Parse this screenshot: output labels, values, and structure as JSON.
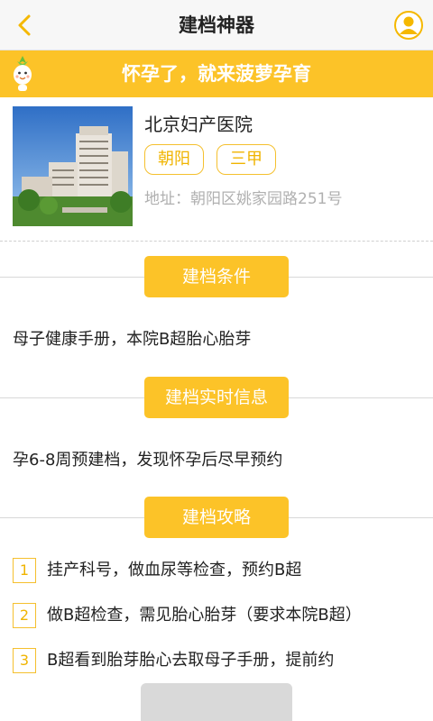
{
  "header": {
    "title": "建档神器",
    "back_icon": "chevron-left-icon",
    "user_icon": "user-avatar-icon"
  },
  "banner": {
    "text": "怀孕了，就来菠萝孕育",
    "mascot_icon": "pineapple-mascot-icon"
  },
  "hospital": {
    "name": "北京妇产医院",
    "district": "朝阳",
    "grade": "三甲",
    "address": "地址：朝阳区姚家园路251号"
  },
  "sections": {
    "conditions": {
      "title": "建档条件",
      "body": "母子健康手册，本院B超胎心胎芽"
    },
    "realtime": {
      "title": "建档实时信息",
      "body": "孕6-8周预建档，发现怀孕后尽早预约"
    },
    "guide": {
      "title": "建档攻略",
      "steps": [
        {
          "num": "1",
          "text": "挂产科号，做血尿等检查，预约B超"
        },
        {
          "num": "2",
          "text": "做B超检查，需见胎心胎芽（要求本院B超）"
        },
        {
          "num": "3",
          "text": "B超看到胎芽胎心去取母子手册，提前约"
        }
      ]
    }
  },
  "colors": {
    "accent": "#fcc328",
    "tag_border": "#f5c02e",
    "tag_text": "#f0b400",
    "address_text": "#b0b0b0"
  }
}
